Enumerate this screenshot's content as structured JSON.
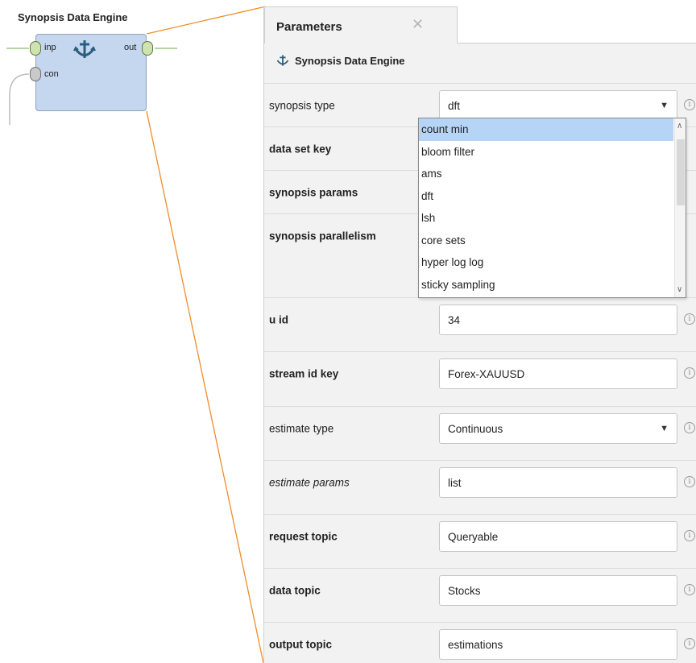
{
  "operator": {
    "title": "Synopsis Data Engine",
    "ports": {
      "in_label": "inp",
      "out_label": "out",
      "con_label": "con"
    },
    "icon": "anchor-split-icon",
    "colors": {
      "box": "#c5d6ef",
      "link": "#f28c28"
    }
  },
  "panel": {
    "tab_label": "Parameters",
    "close_icon": "close-icon",
    "header_label": "Synopsis Data Engine"
  },
  "params": {
    "synopsis_type": {
      "label": "synopsis type",
      "value": "dft"
    },
    "data_set_key": {
      "label": "data set key"
    },
    "synopsis_params": {
      "label": "synopsis params"
    },
    "synopsis_parallelism": {
      "label": "synopsis parallelism"
    },
    "u_id": {
      "label": "u id",
      "value": "34"
    },
    "stream_id_key": {
      "label": "stream id key",
      "value": "Forex-XAUUSD"
    },
    "estimate_type": {
      "label": "estimate type",
      "value": "Continuous"
    },
    "estimate_params": {
      "label": "estimate params",
      "value": "list"
    },
    "request_topic": {
      "label": "request topic",
      "value": "Queryable"
    },
    "data_topic": {
      "label": "data topic",
      "value": "Stocks"
    },
    "output_topic": {
      "label": "output topic",
      "value": "estimations"
    }
  },
  "dropdown": {
    "options": [
      "count min",
      "bloom filter",
      "ams",
      "dft",
      "lsh",
      "core sets",
      "hyper log log",
      "sticky sampling"
    ],
    "highlighted": "count min"
  }
}
